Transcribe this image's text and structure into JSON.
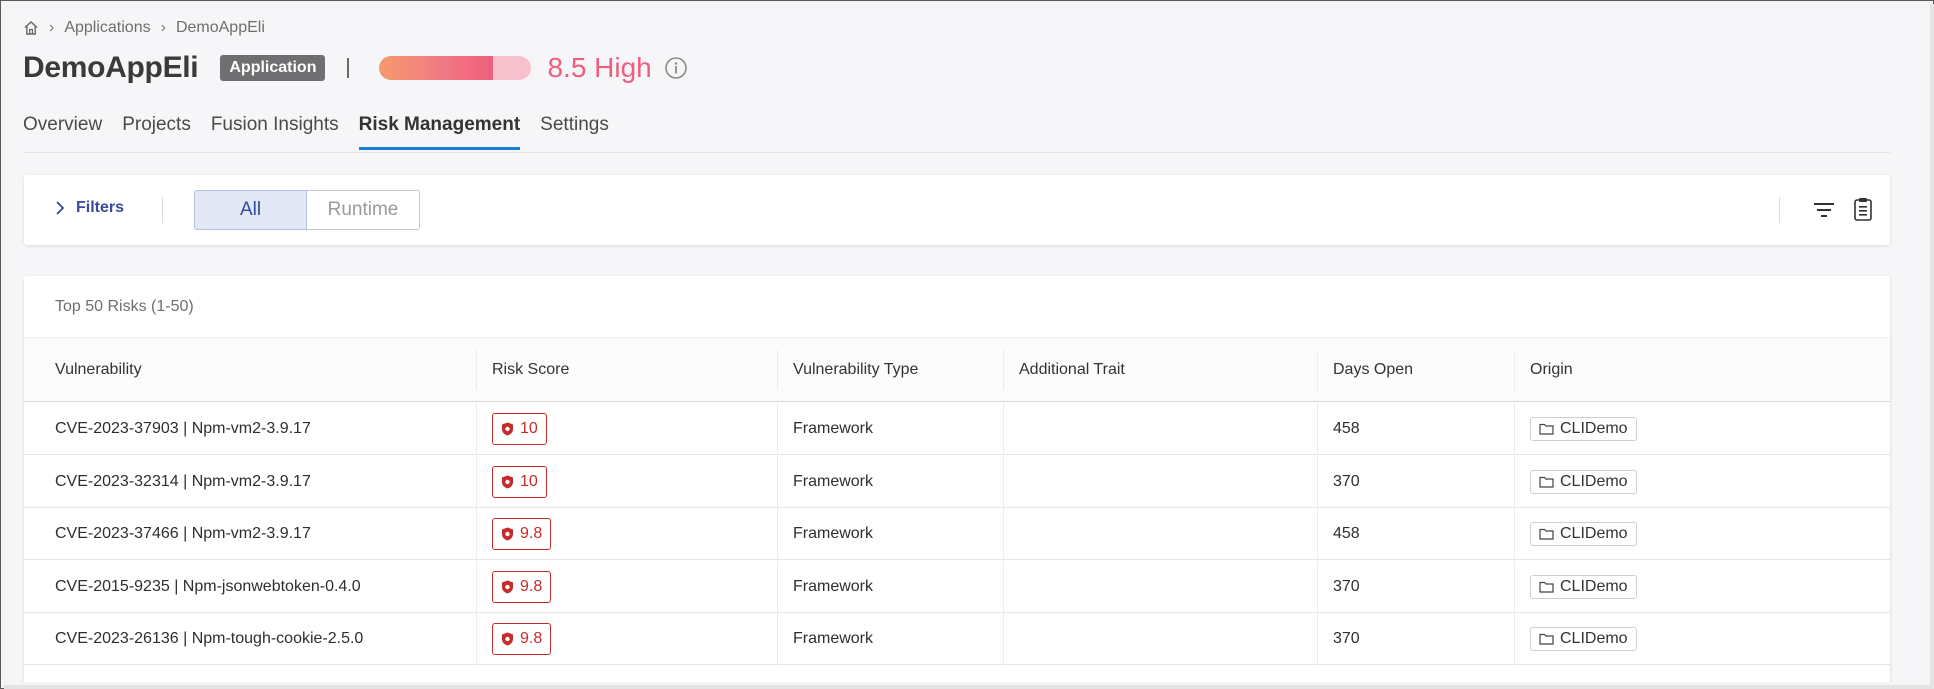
{
  "breadcrumb": {
    "home_icon": "home-icon",
    "items": [
      "Applications",
      "DemoAppEli"
    ]
  },
  "header": {
    "title": "DemoAppEli",
    "type_badge": "Application",
    "risk_level_fraction": 0.75,
    "risk_text": "8.5 High",
    "info_icon": "info-icon"
  },
  "tabs": [
    {
      "label": "Overview",
      "active": false
    },
    {
      "label": "Projects",
      "active": false
    },
    {
      "label": "Fusion Insights",
      "active": false
    },
    {
      "label": "Risk Management",
      "active": true
    },
    {
      "label": "Settings",
      "active": false
    }
  ],
  "filters": {
    "label": "Filters",
    "segments": [
      {
        "label": "All",
        "active": true
      },
      {
        "label": "Runtime",
        "active": false
      }
    ],
    "sort_icon": "sort-icon",
    "clipboard_icon": "clipboard-icon"
  },
  "table": {
    "caption": "Top 50 Risks (1-50)",
    "columns": [
      "Vulnerability",
      "Risk Score",
      "Vulnerability Type",
      "Additional Trait",
      "Days Open",
      "Origin"
    ],
    "rows": [
      {
        "vulnerability": "CVE-2023-37903 | Npm-vm2-3.9.17",
        "risk_score": "10",
        "type": "Framework",
        "trait": "",
        "days_open": "458",
        "origin": "CLIDemo"
      },
      {
        "vulnerability": "CVE-2023-32314 | Npm-vm2-3.9.17",
        "risk_score": "10",
        "type": "Framework",
        "trait": "",
        "days_open": "370",
        "origin": "CLIDemo"
      },
      {
        "vulnerability": "CVE-2023-37466 | Npm-vm2-3.9.17",
        "risk_score": "9.8",
        "type": "Framework",
        "trait": "",
        "days_open": "458",
        "origin": "CLIDemo"
      },
      {
        "vulnerability": "CVE-2015-9235 | Npm-jsonwebtoken-0.4.0",
        "risk_score": "9.8",
        "type": "Framework",
        "trait": "",
        "days_open": "370",
        "origin": "CLIDemo"
      },
      {
        "vulnerability": "CVE-2023-26136 | Npm-tough-cookie-2.5.0",
        "risk_score": "9.8",
        "type": "Framework",
        "trait": "",
        "days_open": "370",
        "origin": "CLIDemo"
      }
    ]
  },
  "colors": {
    "accent": "#1a7fd4",
    "risk_high": "#ee5e7f",
    "critical_badge": "#c62b2b",
    "filters_link": "#3a4a9e"
  }
}
